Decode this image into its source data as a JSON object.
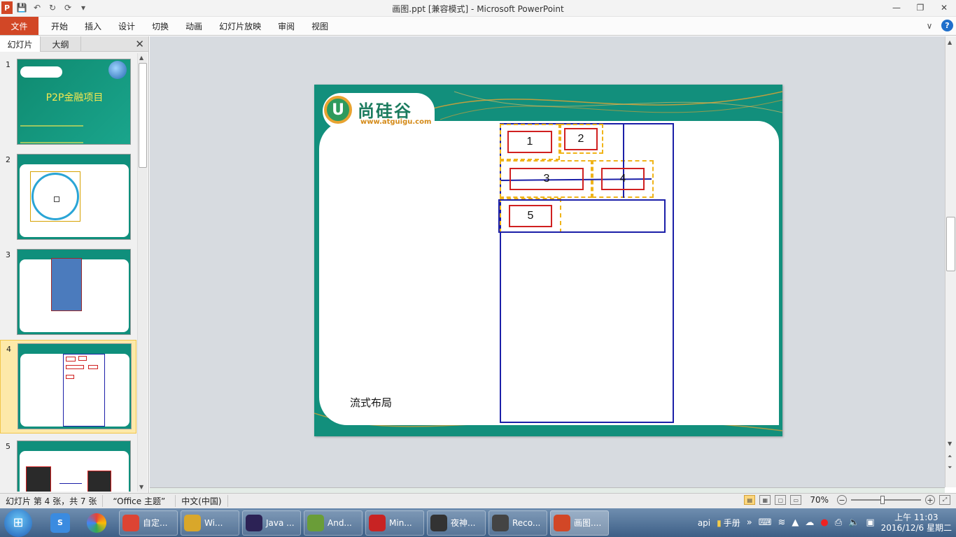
{
  "window": {
    "title": "画图.ppt [兼容模式]  -  Microsoft PowerPoint",
    "minimize": "—",
    "maximize": "❐",
    "close": "✕"
  },
  "qat": {
    "app_logo": "P",
    "save": "💾",
    "undo": "↶",
    "redo": "↻",
    "repeat": "⟳",
    "customize": "▾"
  },
  "ribbon": {
    "tabs": [
      "文件",
      "开始",
      "插入",
      "设计",
      "切换",
      "动画",
      "幻灯片放映",
      "审阅",
      "视图"
    ],
    "collapse": "∨",
    "help": "?"
  },
  "left_pane": {
    "tabs": [
      "幻灯片",
      "大纲"
    ],
    "close": "✕",
    "thumbnails": [
      {
        "number": "1",
        "title": "P2P金融项目"
      },
      {
        "number": "2"
      },
      {
        "number": "3"
      },
      {
        "number": "4"
      },
      {
        "number": "5"
      }
    ],
    "selected": 4
  },
  "slide": {
    "logo_text": "尚硅谷",
    "logo_url": "www.atguigu.com",
    "caption": "流式布局",
    "boxes": [
      "1",
      "2",
      "3",
      "4",
      "5"
    ]
  },
  "statusbar": {
    "slide_info": "幻灯片 第 4 张，共 7 张",
    "theme": "“Office 主题”",
    "language": "中文(中国)",
    "zoom": "70%",
    "zoom_level": 0.45
  },
  "taskbar": {
    "start": "⊞",
    "pinned": [
      "sogou",
      "photos"
    ],
    "tasks": [
      {
        "label": "自定...",
        "icon": "chrome-icon",
        "color": "#dd4433"
      },
      {
        "label": "Wi...",
        "icon": "explorer-icon",
        "color": "#d9a72a"
      },
      {
        "label": "Java ...",
        "icon": "eclipse-icon",
        "color": "#2c2255"
      },
      {
        "label": "And...",
        "icon": "android-studio-icon",
        "color": "#6a9d38"
      },
      {
        "label": "Min...",
        "icon": "mindmanager-icon",
        "color": "#c82323"
      },
      {
        "label": "夜神...",
        "icon": "nox-icon",
        "color": "#333333"
      },
      {
        "label": "Reco...",
        "icon": "recorder-icon",
        "color": "#444444"
      },
      {
        "label": "画图....",
        "icon": "powerpoint-icon",
        "color": "#d24726"
      }
    ],
    "tray": {
      "text1": "api",
      "text2": "手册",
      "time": "上午 11:03",
      "date": "2016/12/6 星期二"
    }
  }
}
